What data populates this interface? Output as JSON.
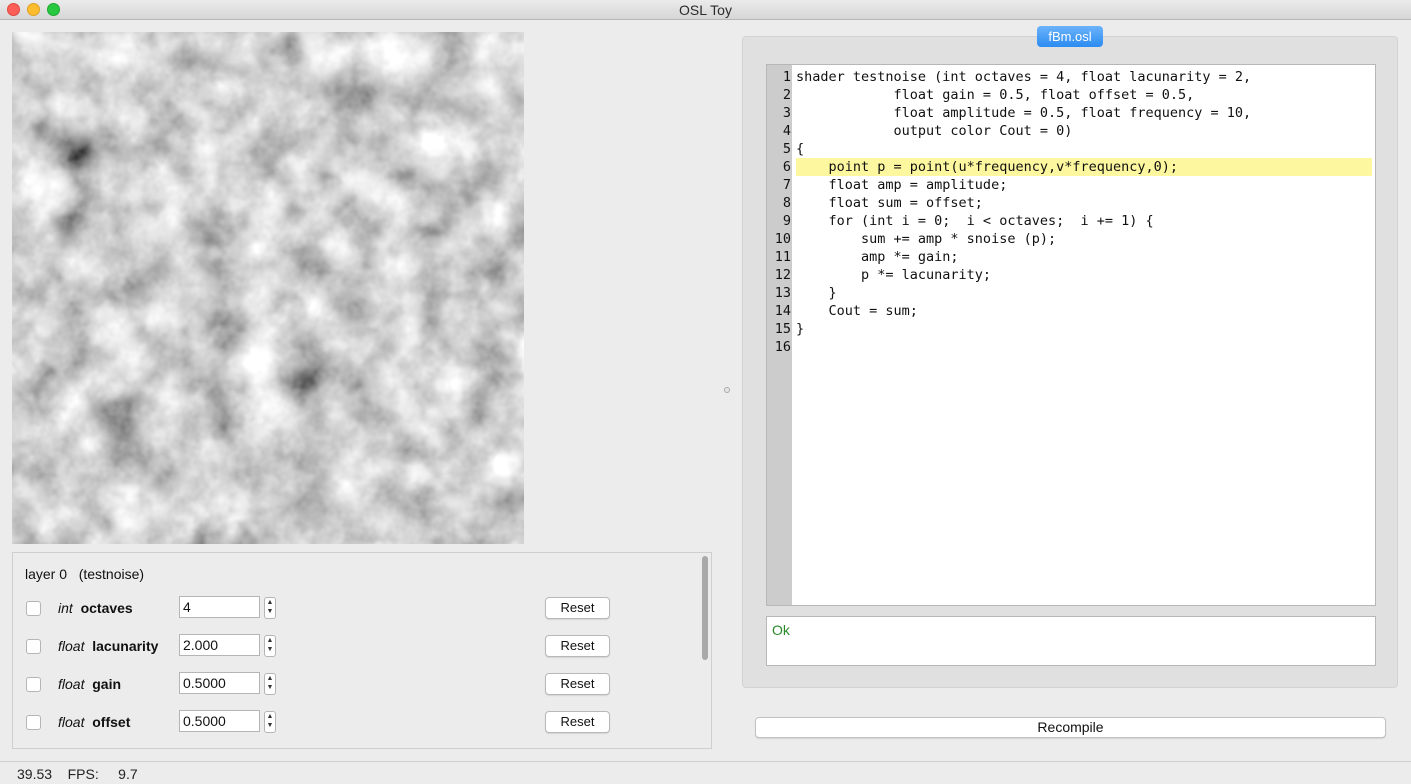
{
  "window": {
    "title": "OSL Toy"
  },
  "layer": {
    "title": "layer 0   (testnoise)"
  },
  "params": [
    {
      "type": "int",
      "name": "octaves",
      "value": "4",
      "reset": "Reset"
    },
    {
      "type": "float",
      "name": "lacunarity",
      "value": "2.000",
      "reset": "Reset"
    },
    {
      "type": "float",
      "name": "gain",
      "value": "0.5000",
      "reset": "Reset"
    },
    {
      "type": "float",
      "name": "offset",
      "value": "0.5000",
      "reset": "Reset"
    }
  ],
  "editor": {
    "tab": "fBm.osl",
    "highlight_line": 6,
    "lines": [
      "shader testnoise (int octaves = 4, float lacunarity = 2,",
      "            float gain = 0.5, float offset = 0.5,",
      "            float amplitude = 0.5, float frequency = 10,",
      "            output color Cout = 0)",
      "{",
      "    point p = point(u*frequency,v*frequency,0);",
      "    float amp = amplitude;",
      "    float sum = offset;",
      "    for (int i = 0;  i < octaves;  i += 1) {",
      "        sum += amp * snoise (p);",
      "        amp *= gain;",
      "        p *= lacunarity;",
      "    }",
      "    Cout = sum;",
      "}",
      ""
    ],
    "message": "Ok",
    "message_color": "#2a8a2a",
    "highlight_color": "#fdf79f"
  },
  "recompile_label": "Recompile",
  "status": {
    "text": "39.53    FPS:     9.7"
  },
  "colors": {
    "tab_accent": "#2a8cf2"
  }
}
